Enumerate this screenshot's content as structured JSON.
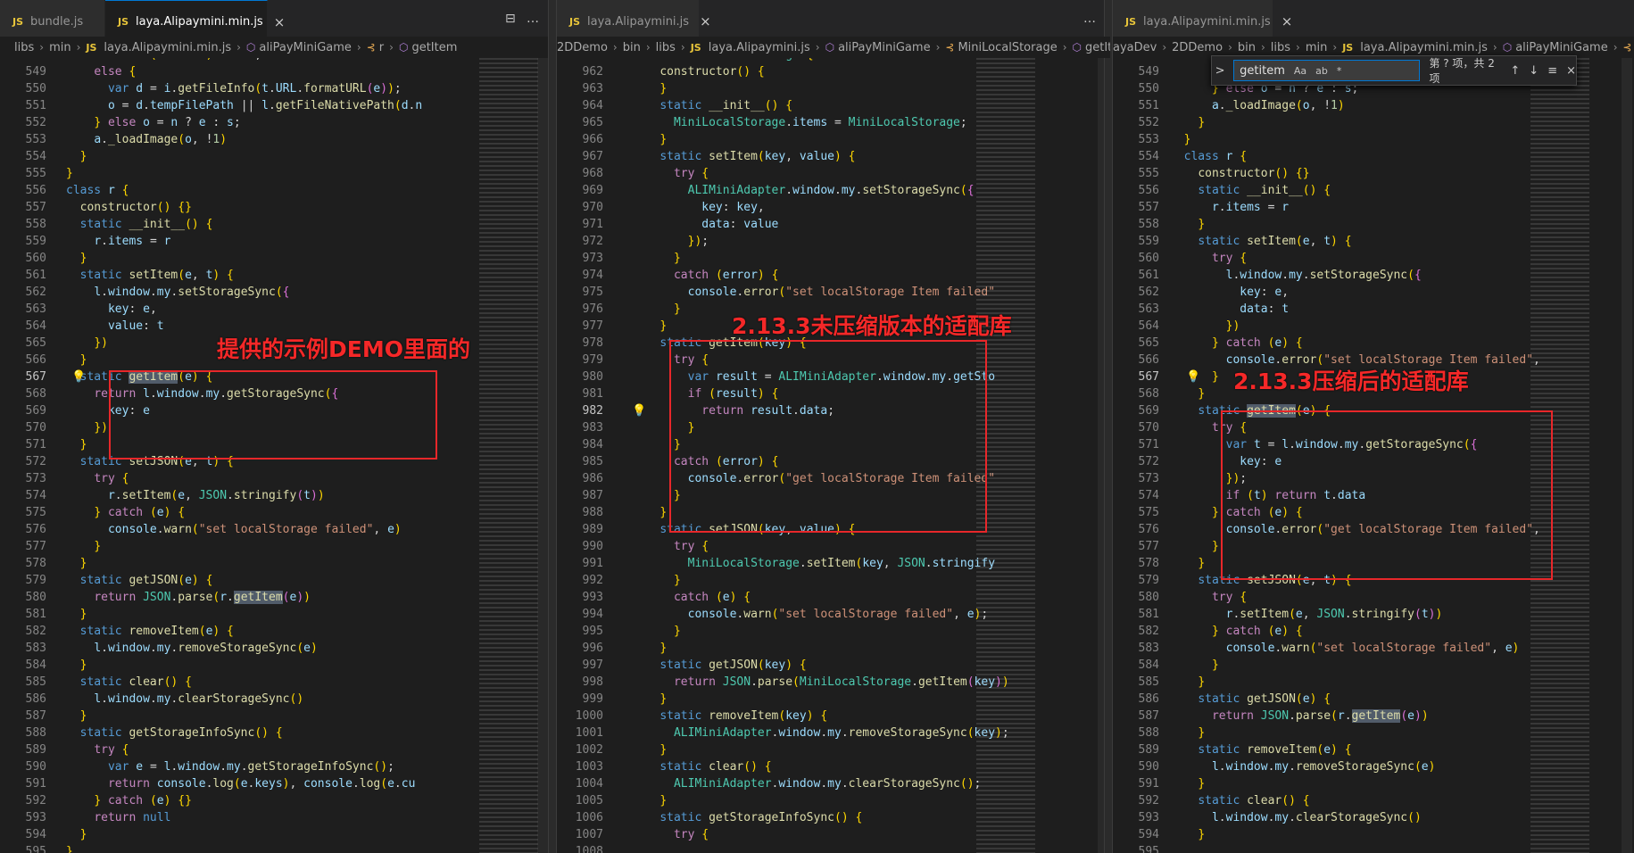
{
  "panes": [
    {
      "id": "p1",
      "tabs": [
        {
          "label": "bundle.js",
          "active": false
        },
        {
          "label": "laya.Alipaymini.min.js",
          "active": true,
          "close": "×"
        }
      ],
      "breadcrumb": [
        "libs",
        "min",
        "laya.Alipaymini.min.js",
        "aliPayMiniGame",
        "r",
        "getItem"
      ],
      "annotation": "提供的示例DEMO里面的",
      "lines": [
        {
          "n": "548",
          "text": "    else if (   != s) o = s;"
        },
        {
          "n": "549",
          "text": "    else {"
        },
        {
          "n": "550",
          "text": "      var d = i.getFileInfo(t.URL.formatURL(e));"
        },
        {
          "n": "551",
          "text": "      o = d.tempFilePath || l.getFileNativePath(d.n"
        },
        {
          "n": "552",
          "text": "    } else o = n ? e : s;"
        },
        {
          "n": "553",
          "text": "    a._loadImage(o, !1)"
        },
        {
          "n": "554",
          "text": "  }"
        },
        {
          "n": "555",
          "text": "}"
        },
        {
          "n": "556",
          "text": "class r {"
        },
        {
          "n": "557",
          "text": "  constructor() {}"
        },
        {
          "n": "558",
          "text": "  static __init__() {"
        },
        {
          "n": "559",
          "text": "    r.items = r"
        },
        {
          "n": "560",
          "text": "  }"
        },
        {
          "n": "561",
          "text": "  static setItem(e, t) {"
        },
        {
          "n": "562",
          "text": "    l.window.my.setStorageSync({"
        },
        {
          "n": "563",
          "text": "      key: e,"
        },
        {
          "n": "564",
          "text": "      value: t"
        },
        {
          "n": "565",
          "text": "    })"
        },
        {
          "n": "566",
          "text": "  }"
        },
        {
          "n": "567",
          "text": "  static getItem(e) {"
        },
        {
          "n": "568",
          "text": "    return l.window.my.getStorageSync({"
        },
        {
          "n": "569",
          "text": "      key: e"
        },
        {
          "n": "570",
          "text": "    })"
        },
        {
          "n": "571",
          "text": "  }"
        },
        {
          "n": "572",
          "text": "  static setJSON(e, t) {"
        },
        {
          "n": "573",
          "text": "    try {"
        },
        {
          "n": "574",
          "text": "      r.setItem(e, JSON.stringify(t))"
        },
        {
          "n": "575",
          "text": "    } catch (e) {"
        },
        {
          "n": "576",
          "text": "      console.warn(\"set localStorage failed\", e)"
        },
        {
          "n": "577",
          "text": "    }"
        },
        {
          "n": "578",
          "text": "  }"
        },
        {
          "n": "579",
          "text": "  static getJSON(e) {"
        },
        {
          "n": "580",
          "text": "    return JSON.parse(r.getItem(e))"
        },
        {
          "n": "581",
          "text": "  }"
        },
        {
          "n": "582",
          "text": "  static removeItem(e) {"
        },
        {
          "n": "583",
          "text": "    l.window.my.removeStorageSync(e)"
        },
        {
          "n": "584",
          "text": "  }"
        },
        {
          "n": "585",
          "text": "  static clear() {"
        },
        {
          "n": "586",
          "text": "    l.window.my.clearStorageSync()"
        },
        {
          "n": "587",
          "text": "  }"
        },
        {
          "n": "588",
          "text": "  static getStorageInfoSync() {"
        },
        {
          "n": "589",
          "text": "    try {"
        },
        {
          "n": "590",
          "text": "      var e = l.window.my.getStorageInfoSync();"
        },
        {
          "n": "591",
          "text": "      return console.log(e.keys), console.log(e.cu"
        },
        {
          "n": "592",
          "text": "    } catch (e) {}"
        },
        {
          "n": "593",
          "text": "    return null"
        },
        {
          "n": "594",
          "text": "  }"
        },
        {
          "n": "595",
          "text": "}"
        }
      ]
    },
    {
      "id": "p2",
      "tabs": [
        {
          "label": "laya.Alipaymini.js",
          "active": false,
          "close": "×"
        }
      ],
      "breadcrumb": [
        "2DDemo",
        "bin",
        "libs",
        "laya.Alipaymini.js",
        "aliPayMiniGame",
        "MiniLocalStorage",
        "getItem"
      ],
      "annotation": "2.13.3未压缩版本的适配库",
      "lines": [
        {
          "n": "961",
          "text": "  class MiniLocalStorage {"
        },
        {
          "n": "962",
          "text": "    constructor() {"
        },
        {
          "n": "963",
          "text": "    }"
        },
        {
          "n": "964",
          "text": "    static __init__() {"
        },
        {
          "n": "965",
          "text": "      MiniLocalStorage.items = MiniLocalStorage;"
        },
        {
          "n": "966",
          "text": "    }"
        },
        {
          "n": "967",
          "text": "    static setItem(key, value) {"
        },
        {
          "n": "968",
          "text": "      try {"
        },
        {
          "n": "969",
          "text": "        ALIMiniAdapter.window.my.setStorageSync({"
        },
        {
          "n": "970",
          "text": "          key: key,"
        },
        {
          "n": "971",
          "text": "          data: value"
        },
        {
          "n": "972",
          "text": "        });"
        },
        {
          "n": "973",
          "text": "      }"
        },
        {
          "n": "974",
          "text": "      catch (error) {"
        },
        {
          "n": "975",
          "text": "        console.error(\"set localStorage Item failed\""
        },
        {
          "n": "976",
          "text": "      }"
        },
        {
          "n": "977",
          "text": "    }"
        },
        {
          "n": "978",
          "text": "    static getItem(key) {"
        },
        {
          "n": "979",
          "text": "      try {"
        },
        {
          "n": "980",
          "text": "        var result = ALIMiniAdapter.window.my.getSto"
        },
        {
          "n": "981",
          "text": "        if (result) {"
        },
        {
          "n": "982",
          "text": "          return result.data;"
        },
        {
          "n": "983",
          "text": "        }"
        },
        {
          "n": "984",
          "text": "      }"
        },
        {
          "n": "985",
          "text": "      catch (error) {"
        },
        {
          "n": "986",
          "text": "        console.error(\"get localStorage Item failed\""
        },
        {
          "n": "987",
          "text": "      }"
        },
        {
          "n": "988",
          "text": "    }"
        },
        {
          "n": "989",
          "text": "    static setJSON(key, value) {"
        },
        {
          "n": "990",
          "text": "      try {"
        },
        {
          "n": "991",
          "text": "        MiniLocalStorage.setItem(key, JSON.stringify"
        },
        {
          "n": "992",
          "text": "      }"
        },
        {
          "n": "993",
          "text": "      catch (e) {"
        },
        {
          "n": "994",
          "text": "        console.warn(\"set localStorage failed\", e);"
        },
        {
          "n": "995",
          "text": "      }"
        },
        {
          "n": "996",
          "text": "    }"
        },
        {
          "n": "997",
          "text": "    static getJSON(key) {"
        },
        {
          "n": "998",
          "text": "      return JSON.parse(MiniLocalStorage.getItem(key))"
        },
        {
          "n": "999",
          "text": "    }"
        },
        {
          "n": "1000",
          "text": "    static removeItem(key) {"
        },
        {
          "n": "1001",
          "text": "      ALIMiniAdapter.window.my.removeStorageSync(key);"
        },
        {
          "n": "1002",
          "text": "    }"
        },
        {
          "n": "1003",
          "text": "    static clear() {"
        },
        {
          "n": "1004",
          "text": "      ALIMiniAdapter.window.my.clearStorageSync();"
        },
        {
          "n": "1005",
          "text": "    }"
        },
        {
          "n": "1006",
          "text": "    static getStorageInfoSync() {"
        },
        {
          "n": "1007",
          "text": "      try {"
        },
        {
          "n": "1008",
          "text": ""
        }
      ]
    },
    {
      "id": "p3",
      "tabs": [
        {
          "label": "laya.Alipaymini.min.js",
          "active": false,
          "close": "×"
        }
      ],
      "breadcrumb": [
        "ayaDev",
        "2DDemo",
        "bin",
        "libs",
        "min",
        "laya.Alipaymini.min.js",
        "aliPayMiniGame",
        "r"
      ],
      "annotation": "2.13.3压缩后的适配库",
      "find": {
        "value": "getitem",
        "toggle": ">",
        "options": [
          "Aa",
          "ab",
          "*"
        ],
        "count": "第 ? 项，共 2 项",
        "buttons": [
          "↑",
          "↓",
          "≡",
          "×"
        ]
      },
      "lines": [
        {
          "n": "548",
          "text": ""
        },
        {
          "n": "549",
          "text": ""
        },
        {
          "n": "550",
          "text": "      } else o = n ? e : s;"
        },
        {
          "n": "551",
          "text": "      a._loadImage(o, !1)"
        },
        {
          "n": "552",
          "text": "    }"
        },
        {
          "n": "553",
          "text": "  }"
        },
        {
          "n": "554",
          "text": "  class r {"
        },
        {
          "n": "555",
          "text": "    constructor() {}"
        },
        {
          "n": "556",
          "text": "    static __init__() {"
        },
        {
          "n": "557",
          "text": "      r.items = r"
        },
        {
          "n": "558",
          "text": "    }"
        },
        {
          "n": "559",
          "text": "    static setItem(e, t) {"
        },
        {
          "n": "560",
          "text": "      try {"
        },
        {
          "n": "561",
          "text": "        l.window.my.setStorageSync({"
        },
        {
          "n": "562",
          "text": "          key: e,"
        },
        {
          "n": "563",
          "text": "          data: t"
        },
        {
          "n": "564",
          "text": "        })"
        },
        {
          "n": "565",
          "text": "      } catch (e) {"
        },
        {
          "n": "566",
          "text": "        console.error(\"set localStorage Item failed\","
        },
        {
          "n": "567",
          "text": "      }"
        },
        {
          "n": "568",
          "text": "    }"
        },
        {
          "n": "569",
          "text": "    static getItem(e) {"
        },
        {
          "n": "570",
          "text": "      try {"
        },
        {
          "n": "571",
          "text": "        var t = l.window.my.getStorageSync({"
        },
        {
          "n": "572",
          "text": "          key: e"
        },
        {
          "n": "573",
          "text": "        });"
        },
        {
          "n": "574",
          "text": "        if (t) return t.data"
        },
        {
          "n": "575",
          "text": "      } catch (e) {"
        },
        {
          "n": "576",
          "text": "        console.error(\"get localStorage Item failed\","
        },
        {
          "n": "577",
          "text": "      }"
        },
        {
          "n": "578",
          "text": "    }"
        },
        {
          "n": "579",
          "text": "    static setJSON(e, t) {"
        },
        {
          "n": "580",
          "text": "      try {"
        },
        {
          "n": "581",
          "text": "        r.setItem(e, JSON.stringify(t))"
        },
        {
          "n": "582",
          "text": "      } catch (e) {"
        },
        {
          "n": "583",
          "text": "        console.warn(\"set localStorage failed\", e)"
        },
        {
          "n": "584",
          "text": "      }"
        },
        {
          "n": "585",
          "text": "    }"
        },
        {
          "n": "586",
          "text": "    static getJSON(e) {"
        },
        {
          "n": "587",
          "text": "      return JSON.parse(r.getItem(e))"
        },
        {
          "n": "588",
          "text": "    }"
        },
        {
          "n": "589",
          "text": "    static removeItem(e) {"
        },
        {
          "n": "590",
          "text": "      l.window.my.removeStorageSync(e)"
        },
        {
          "n": "591",
          "text": "    }"
        },
        {
          "n": "592",
          "text": "    static clear() {"
        },
        {
          "n": "593",
          "text": "      l.window.my.clearStorageSync()"
        },
        {
          "n": "594",
          "text": "    }"
        },
        {
          "n": "595",
          "text": ""
        }
      ]
    }
  ],
  "colors": {
    "annotation": "#f52828",
    "box": "#e8272a",
    "editor_bg": "#1e1e1e",
    "keyword": "#569cd6",
    "function": "#dcdcaa",
    "string": "#ce9178"
  },
  "icons": {
    "lightbulb": "lightbulb-icon",
    "split": "split-editor-icon",
    "more": "more-actions-icon",
    "js": "js-file-icon",
    "symbol": "symbol-method-icon"
  }
}
